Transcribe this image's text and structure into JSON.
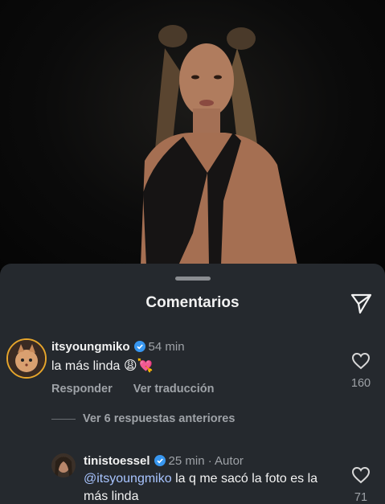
{
  "sheet": {
    "title": "Comentarios",
    "icons": {
      "share": "send-paper-plane-icon",
      "heart": "heart-outline-icon",
      "verified": "verified-badge-icon"
    }
  },
  "comments": [
    {
      "username": "itsyoungmiko",
      "time": "54 min",
      "text": "la más linda 😩💘",
      "likes": "160",
      "reply_label": "Responder",
      "translate_label": "Ver traducción"
    },
    {
      "view_replies_label": "Ver 6 respuestas anteriores"
    },
    {
      "username": "tinistoessel",
      "time": "25 min · Autor",
      "mention": "@itsyoungmiko",
      "text": " la q me sacó la foto es la más linda",
      "likes": "71"
    }
  ],
  "colors": {
    "sheet_bg": "#25292e",
    "verified_blue": "#3897f0",
    "mention": "#a8c4ff",
    "muted": "#9ea2a7"
  }
}
